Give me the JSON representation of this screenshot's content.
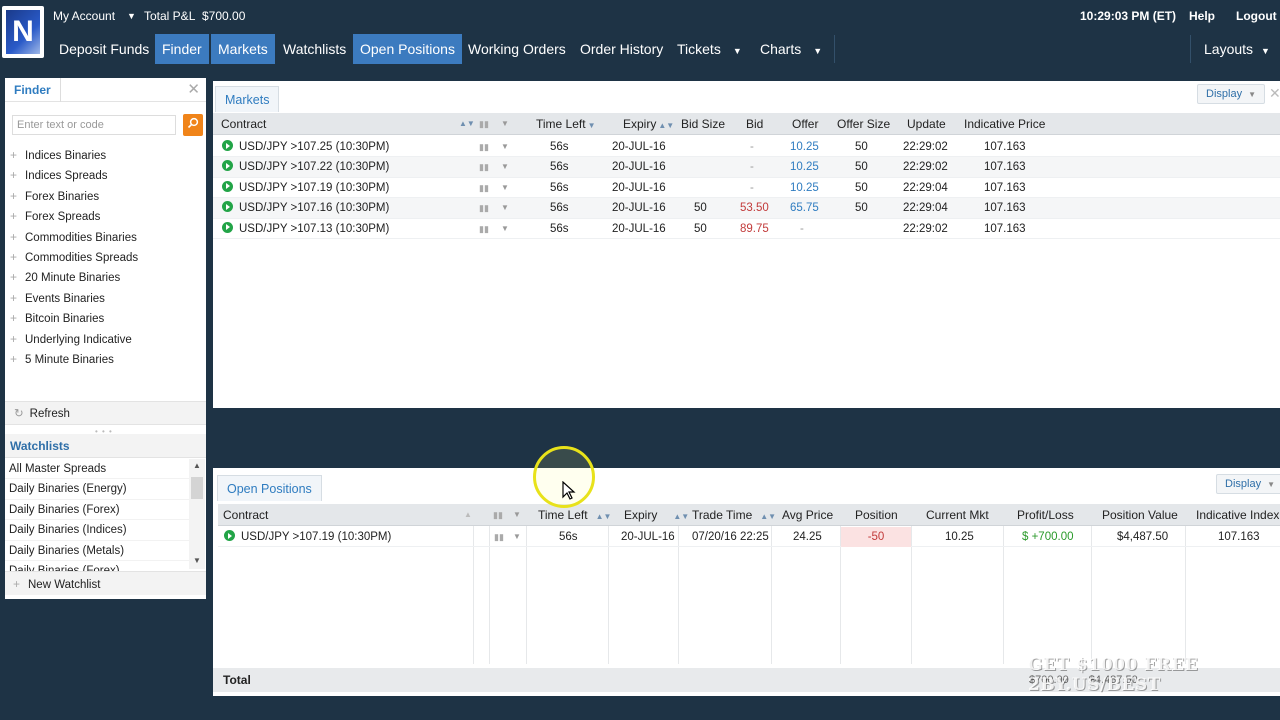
{
  "topbar": {
    "logo_letter": "N",
    "account_label": "My Account",
    "pnl_label": "Total P&L",
    "pnl_value": "$700.00",
    "clock": "10:29:03 PM (ET)",
    "help": "Help",
    "logout": "Logout"
  },
  "nav": {
    "items": [
      "Deposit Funds",
      "Finder",
      "Markets",
      "Watchlists",
      "Open Positions",
      "Working Orders",
      "Order History",
      "Tickets",
      "Charts"
    ],
    "layouts": "Layouts"
  },
  "finder": {
    "title": "Finder",
    "search_placeholder": "Enter text or code",
    "items": [
      "Indices Binaries",
      "Indices Spreads",
      "Forex Binaries",
      "Forex Spreads",
      "Commodities Binaries",
      "Commodities Spreads",
      "20 Minute Binaries",
      "Events Binaries",
      "Bitcoin Binaries",
      "Underlying Indicative",
      "5 Minute Binaries"
    ],
    "refresh": "Refresh"
  },
  "watchlists": {
    "title": "Watchlists",
    "items": [
      "All Master Spreads",
      "Daily Binaries (Energy)",
      "Daily Binaries (Forex)",
      "Daily Binaries (Indices)",
      "Daily Binaries (Metals)",
      "Daily Binaries (Forex)"
    ],
    "new": "New Watchlist"
  },
  "markets": {
    "tab": "Markets",
    "display": "Display",
    "columns": [
      "Contract",
      "Time Left",
      "Expiry",
      "Bid Size",
      "Bid",
      "Offer",
      "Offer Size",
      "Update",
      "Indicative Price"
    ],
    "rows": [
      {
        "contract": "USD/JPY >107.25 (10:30PM)",
        "time_left": "56s",
        "expiry": "20-JUL-16",
        "bid_size": "",
        "bid": "-",
        "offer": "10.25",
        "offer_size": "50",
        "update": "22:29:02",
        "indicative": "107.163"
      },
      {
        "contract": "USD/JPY >107.22 (10:30PM)",
        "time_left": "56s",
        "expiry": "20-JUL-16",
        "bid_size": "",
        "bid": "-",
        "offer": "10.25",
        "offer_size": "50",
        "update": "22:29:02",
        "indicative": "107.163"
      },
      {
        "contract": "USD/JPY >107.19 (10:30PM)",
        "time_left": "56s",
        "expiry": "20-JUL-16",
        "bid_size": "",
        "bid": "-",
        "offer": "10.25",
        "offer_size": "50",
        "update": "22:29:04",
        "indicative": "107.163"
      },
      {
        "contract": "USD/JPY >107.16 (10:30PM)",
        "time_left": "56s",
        "expiry": "20-JUL-16",
        "bid_size": "50",
        "bid": "53.50",
        "offer": "65.75",
        "offer_size": "50",
        "update": "22:29:04",
        "indicative": "107.163"
      },
      {
        "contract": "USD/JPY >107.13 (10:30PM)",
        "time_left": "56s",
        "expiry": "20-JUL-16",
        "bid_size": "50",
        "bid": "89.75",
        "offer": "-",
        "offer_size": "",
        "update": "22:29:02",
        "indicative": "107.163"
      }
    ]
  },
  "open_positions": {
    "tab": "Open Positions",
    "display": "Display",
    "columns": [
      "Contract",
      "Time Left",
      "Expiry",
      "Trade Time",
      "Avg Price",
      "Position",
      "Current Mkt",
      "Profit/Loss",
      "Position Value",
      "Indicative Index"
    ],
    "rows": [
      {
        "contract": "USD/JPY >107.19 (10:30PM)",
        "time_left": "56s",
        "expiry": "20-JUL-16",
        "trade_time": "07/20/16 22:25",
        "avg_price": "24.25",
        "position": "-50",
        "current_mkt": "10.25",
        "pnl": "$ +700.00",
        "position_value": "$4,487.50",
        "indicative": "107.163"
      }
    ],
    "total_label": "Total",
    "total_pnl": "$700.00",
    "total_value": "$4,487.50"
  },
  "watermark": {
    "line1": "GET $1000 FREE",
    "line2": "2BY.US/BEST"
  },
  "colors": {
    "navy": "#1e3345",
    "accent_blue": "#3c7bbf",
    "link_blue": "#2f7cc0",
    "orange": "#f08419",
    "green": "#22a447",
    "red": "#c23b3b",
    "highlight": "#e8e21a"
  }
}
